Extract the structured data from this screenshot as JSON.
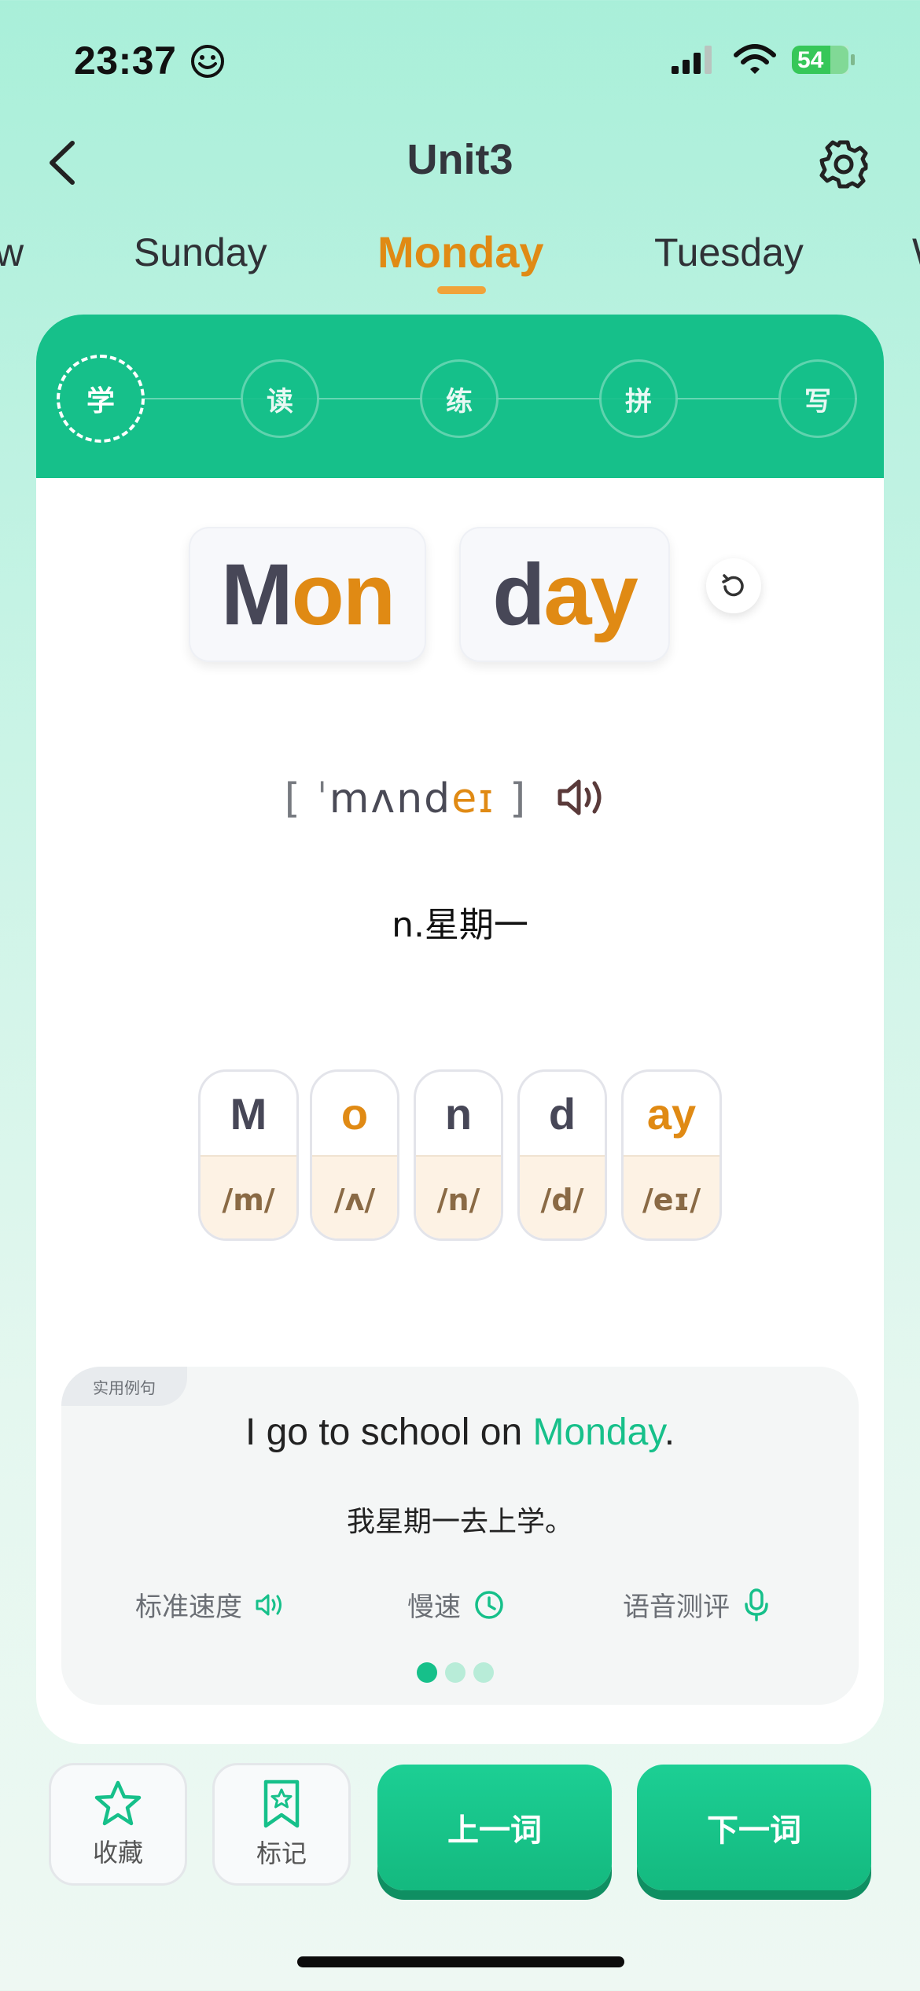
{
  "status_bar": {
    "time": "23:37",
    "battery": "54"
  },
  "header": {
    "title": "Unit3"
  },
  "day_tabs": [
    {
      "label": "w"
    },
    {
      "label": "Sunday"
    },
    {
      "label": "Monday"
    },
    {
      "label": "Tuesday"
    },
    {
      "label": "W"
    }
  ],
  "active_day_index": 2,
  "steps": [
    "学",
    "读",
    "练",
    "拼",
    "写"
  ],
  "active_step_index": 0,
  "word": {
    "syllables": [
      {
        "plain": "M",
        "highlight": "on"
      },
      {
        "plain": "d",
        "highlight": "ay"
      }
    ],
    "phonetic": {
      "open": "[",
      "stress": "ˈ",
      "core": "mʌnd",
      "highlight": "eɪ",
      "close": "]"
    },
    "meaning": "n.星期一"
  },
  "phonics": [
    {
      "letter": "M",
      "sound": "/m/",
      "highlight": false
    },
    {
      "letter": "o",
      "sound": "/ʌ/",
      "highlight": true
    },
    {
      "letter": "n",
      "sound": "/n/",
      "highlight": false
    },
    {
      "letter": "d",
      "sound": "/d/",
      "highlight": false
    },
    {
      "letter": "ay",
      "sound": "/eɪ/",
      "highlight": true
    }
  ],
  "example": {
    "tag": "实用例句",
    "en_before": "I go to school on ",
    "en_keyword": "Monday",
    "en_after": ".",
    "cn": "我星期一去上学。",
    "options": {
      "normal": "标准速度",
      "slow": "慢速",
      "eval": "语音测评"
    },
    "page_count": 3,
    "current_page": 1
  },
  "bottom": {
    "favorite": "收藏",
    "mark": "标记",
    "prev": "上一词",
    "next": "下一词"
  },
  "colors": {
    "accent": "#16c08a",
    "highlight": "#e08a14"
  }
}
